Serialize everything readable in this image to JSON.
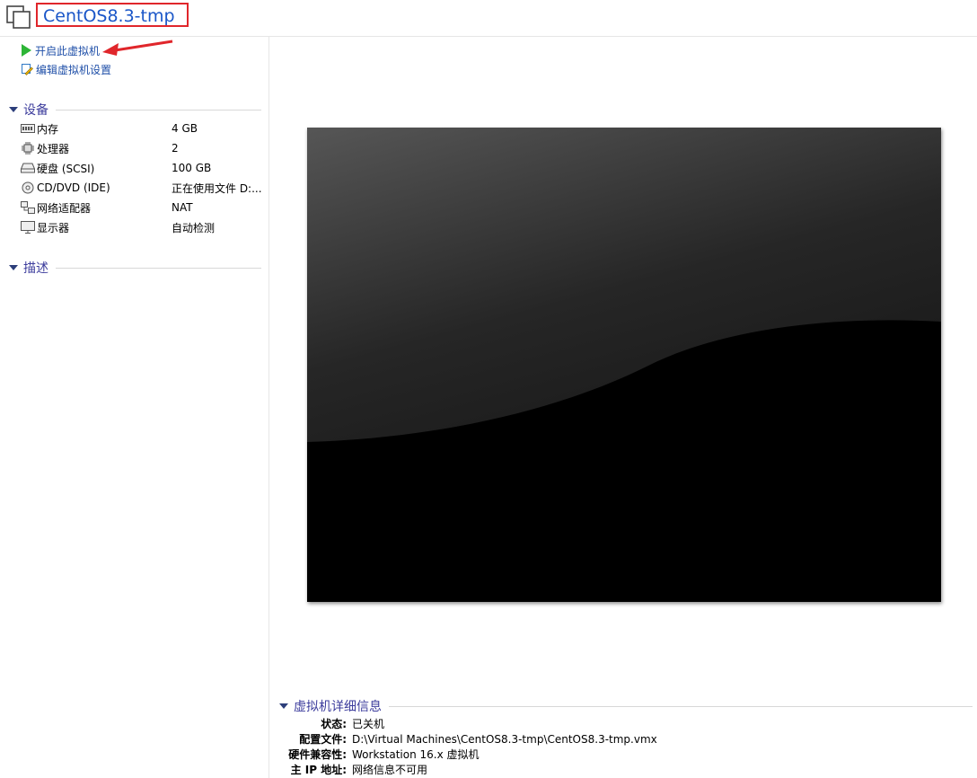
{
  "header": {
    "title": "CentOS8.3-tmp"
  },
  "actions": {
    "power_on": "开启此虚拟机",
    "edit_settings": "编辑虚拟机设置"
  },
  "devices": {
    "section_label": "设备",
    "items": [
      {
        "icon": "memory-icon",
        "name": "内存",
        "value": "4 GB"
      },
      {
        "icon": "cpu-icon",
        "name": "处理器",
        "value": "2"
      },
      {
        "icon": "hard-disk-icon",
        "name": "硬盘 (SCSI)",
        "value": "100 GB"
      },
      {
        "icon": "cd-dvd-icon",
        "name": "CD/DVD (IDE)",
        "value": "正在使用文件 D:..."
      },
      {
        "icon": "network-adapter-icon",
        "name": "网络适配器",
        "value": "NAT"
      },
      {
        "icon": "monitor-icon",
        "name": "显示器",
        "value": "自动检测"
      }
    ]
  },
  "description": {
    "section_label": "描述"
  },
  "details": {
    "section_label": "虚拟机详细信息",
    "rows": [
      {
        "key": "状态:",
        "value": "已关机"
      },
      {
        "key": "配置文件:",
        "value": "D:\\Virtual Machines\\CentOS8.3-tmp\\CentOS8.3-tmp.vmx"
      },
      {
        "key": "硬件兼容性:",
        "value": "Workstation 16.x 虚拟机"
      },
      {
        "key": "主 IP 地址:",
        "value": "网络信息不可用"
      }
    ]
  },
  "colors": {
    "title_text": "#1a56c8",
    "title_border": "#e0262b",
    "link_text": "#1f4fa8",
    "section_text": "#3c3c9c",
    "play_green": "#2db536",
    "annotation_arrow": "#e0262b"
  }
}
